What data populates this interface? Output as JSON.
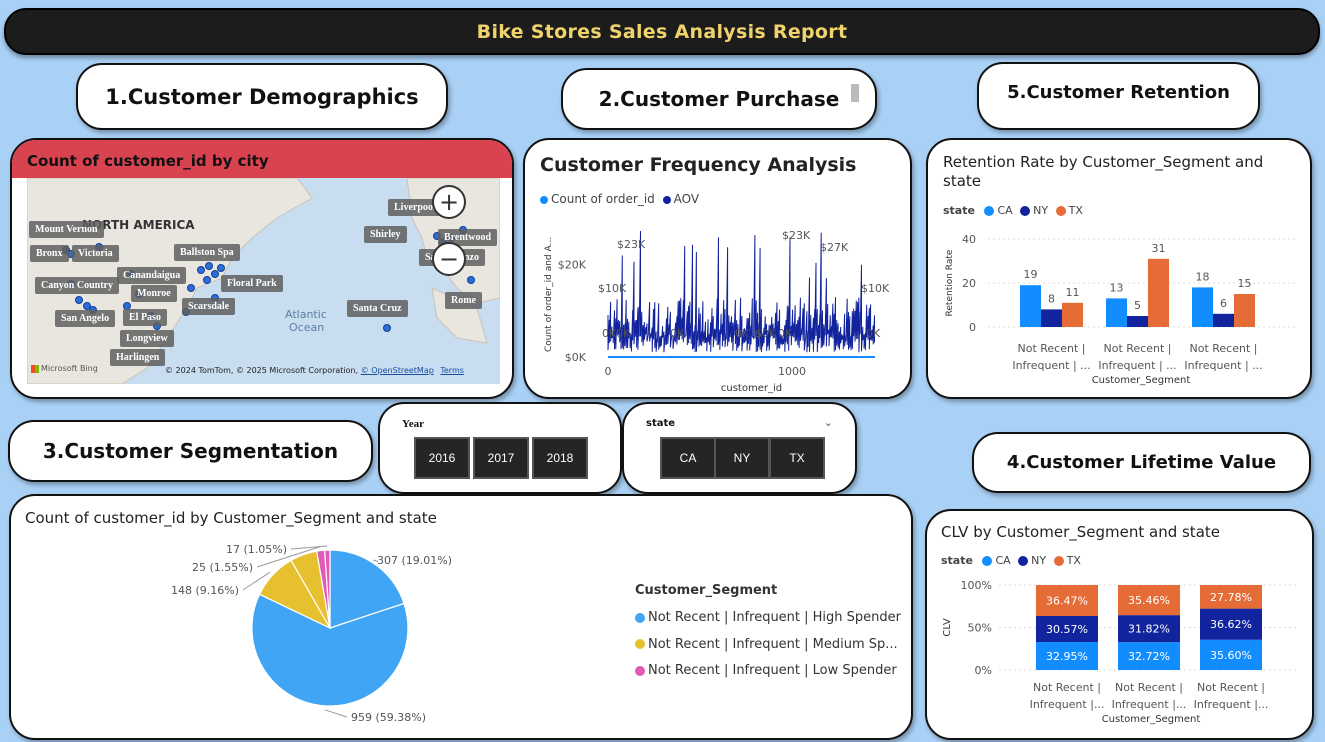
{
  "report": {
    "title": "Bike Stores Sales Analysis Report"
  },
  "sections": {
    "demographics": "1.Customer Demographics",
    "purchase": "2.Customer Purchase",
    "segmentation": "3.Customer Segmentation",
    "lifetime": "4.Customer Lifetime Value",
    "retention": "5.Customer Retention"
  },
  "colors": {
    "ca": "#118dff",
    "ny": "#12239e",
    "tx": "#e66c37",
    "high": "#41a5f5",
    "medium": "#e6c02f",
    "low": "#e05ab6",
    "map_header": "#d9424f"
  },
  "map": {
    "title": "Count of customer_id by city",
    "region_label": "NORTH AMERICA",
    "ocean_label_1": "Atlantic",
    "ocean_label_2": "Ocean",
    "cities": [
      "Mount Vernon",
      "Bronx",
      "Victoria",
      "Ballston Spa",
      "Canandaigua",
      "Canyon Country",
      "Monroe",
      "Floral Park",
      "Scarsdale",
      "San Angelo",
      "El Paso",
      "Longview",
      "Harlingen",
      "Santa Cruz",
      "Liverpool",
      "Shirley",
      "Brentwood",
      "San Lorenzo",
      "Rome"
    ],
    "credit": "© 2024 TomTom, © 2025 Microsoft Corporation,",
    "credit_link": "© OpenStreetMap",
    "terms": "Terms",
    "bing": "Microsoft Bing",
    "zoom_in": "+",
    "zoom_out": "−"
  },
  "slicers": {
    "year": {
      "title": "Year",
      "options": [
        "2016",
        "2017",
        "2018"
      ]
    },
    "state": {
      "title": "state",
      "options": [
        "CA",
        "NY",
        "TX"
      ]
    }
  },
  "chart_data": [
    {
      "id": "frequency",
      "type": "line",
      "title": "Customer Frequency Analysis",
      "legend": [
        "Count of order_id",
        "AOV"
      ],
      "xlabel": "customer_id",
      "ylabel": "Count of order_id and A...",
      "yticks": [
        "$0K",
        "$20K"
      ],
      "xticks": [
        "0",
        "1000"
      ],
      "annotations": [
        "$23K",
        "$23K",
        "$27K",
        "$10K",
        "$10K",
        "0K",
        "0K",
        "0K",
        "0K",
        "$0K",
        "0K",
        "0K"
      ],
      "ylim": [
        0,
        30
      ]
    },
    {
      "id": "retention",
      "type": "bar",
      "title": "Retention Rate by Customer_Segment and state",
      "legend_title": "state",
      "ylabel": "Retention Rate",
      "xlabel": "Customer_Segment",
      "ylim": [
        0,
        40
      ],
      "yticks": [
        "0",
        "20",
        "40"
      ],
      "categories": [
        [
          "Not Recent |",
          "Infrequent | ..."
        ],
        [
          "Not Recent |",
          "Infrequent | ..."
        ],
        [
          "Not Recent |",
          "Infrequent | ..."
        ]
      ],
      "series": [
        {
          "name": "CA",
          "values": [
            19,
            13,
            18
          ]
        },
        {
          "name": "NY",
          "values": [
            8,
            5,
            6
          ]
        },
        {
          "name": "TX",
          "values": [
            11,
            31,
            15
          ]
        }
      ]
    },
    {
      "id": "segment_pie",
      "type": "pie",
      "title": "Count of customer_id by Customer_Segment and state",
      "legend_title": "Customer_Segment",
      "legend": [
        "Not Recent | Infrequent | High Spender",
        "Not Recent | Infrequent | Medium Sp...",
        "Not Recent | Infrequent | Low Spender"
      ],
      "slices": [
        {
          "segment": "High",
          "value": 307,
          "label": "307 (19.01%)"
        },
        {
          "segment": "High",
          "value": 959,
          "label": "959 (59.38%)"
        },
        {
          "segment": "Medium",
          "value": 148,
          "label": "148 (9.16%)"
        },
        {
          "segment": "Medium",
          "value": 86,
          "label": ""
        },
        {
          "segment": "Low",
          "value": 25,
          "label": "25 (1.55%)"
        },
        {
          "segment": "Low",
          "value": 17,
          "label": "17 (1.05%)"
        }
      ]
    },
    {
      "id": "clv",
      "type": "bar",
      "stacked": "100%",
      "title": "CLV by Customer_Segment and state",
      "legend_title": "state",
      "ylabel": "CLV",
      "xlabel": "Customer_Segment",
      "yticks": [
        "0%",
        "50%",
        "100%"
      ],
      "categories": [
        [
          "Not Recent |",
          "Infrequent |..."
        ],
        [
          "Not Recent |",
          "Infrequent |..."
        ],
        [
          "Not Recent |",
          "Infrequent |..."
        ]
      ],
      "series": [
        {
          "name": "CA",
          "values": [
            32.95,
            32.72,
            35.6
          ],
          "labels": [
            "32.95%",
            "32.72%",
            "35.60%"
          ]
        },
        {
          "name": "NY",
          "values": [
            30.57,
            31.82,
            36.62
          ],
          "labels": [
            "30.57%",
            "31.82%",
            "36.62%"
          ]
        },
        {
          "name": "TX",
          "values": [
            36.47,
            35.46,
            27.78
          ],
          "labels": [
            "36.47%",
            "35.46%",
            "27.78%"
          ]
        }
      ]
    }
  ]
}
